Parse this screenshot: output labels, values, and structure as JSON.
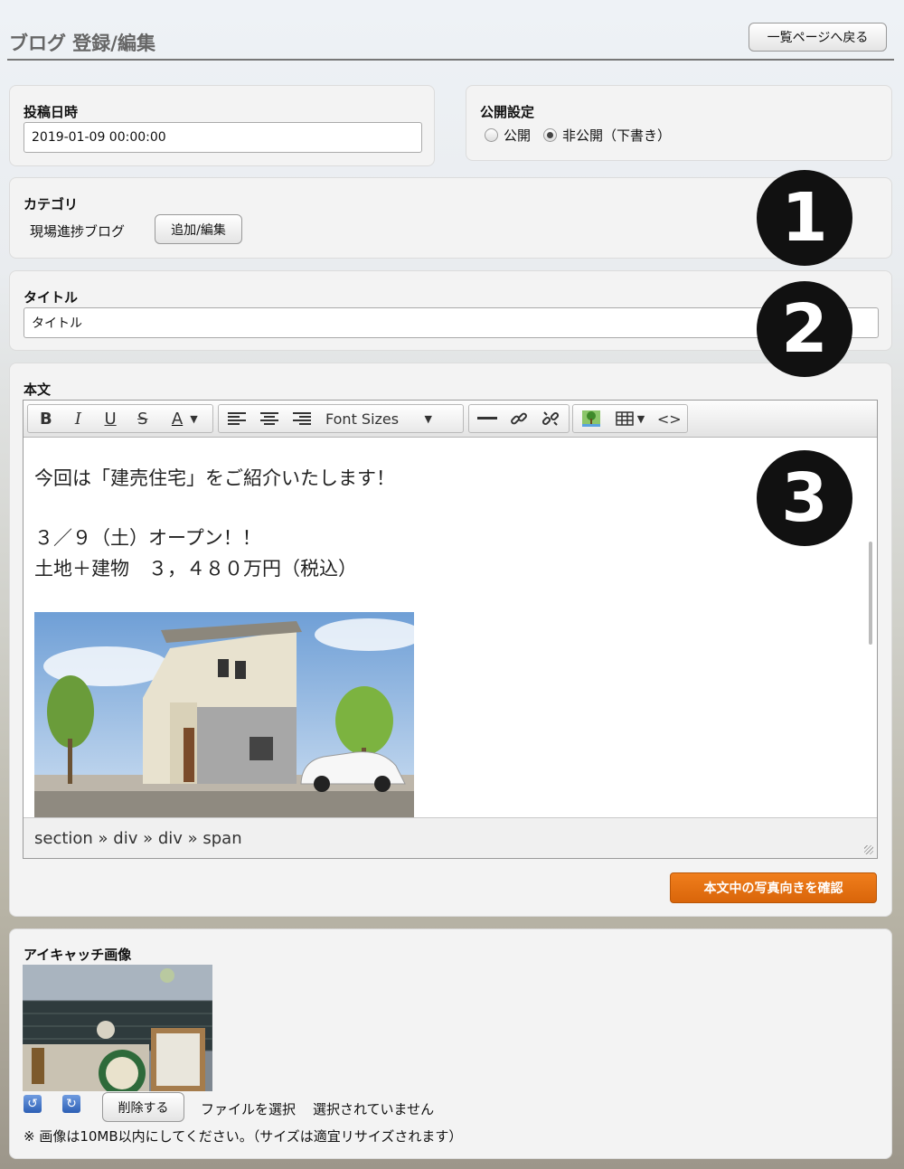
{
  "header": {
    "title": "ブログ 登録/編集",
    "back_label": "一覧ページへ戻る"
  },
  "post_date": {
    "label": "投稿日時",
    "value": "2019-01-09 00:00:00"
  },
  "visibility": {
    "label": "公開設定",
    "options": [
      "公開",
      "非公開（下書き）"
    ],
    "selected": "非公開（下書き）"
  },
  "category": {
    "label": "カテゴリ",
    "value": "現場進捗ブログ",
    "edit_label": "追加/編集"
  },
  "title_field": {
    "label": "タイトル",
    "value": "タイトル"
  },
  "badges": [
    "1",
    "2",
    "3"
  ],
  "body": {
    "label": "本文",
    "toolbar": {
      "font_sizes": "Font Sizes"
    },
    "lines": [
      "今回は「建売住宅」をご紹介いたします！",
      "３／９（土）オープン！！",
      "土地＋建物　３，４８０万円（税込）"
    ],
    "statusbar": "section » div » div » span",
    "check_photo_label": "本文中の写真向きを確認"
  },
  "eyecatch": {
    "label": "アイキャッチ画像",
    "delete_label": "削除する",
    "file_select_label": "ファイルを選択",
    "file_status": "選択されていません",
    "note": "※ 画像は10MB以内にしてください。（サイズは適宜リサイズされます）"
  },
  "colors": {
    "accent_orange": "#e8731a",
    "badge": "#111111"
  }
}
